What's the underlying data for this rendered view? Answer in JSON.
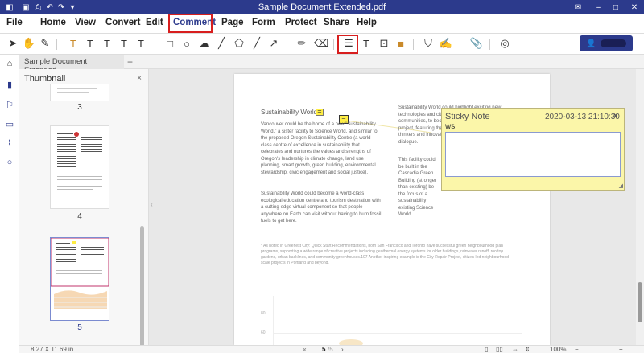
{
  "window": {
    "title": "Sample Document Extended.pdf"
  },
  "menubar": {
    "file": "File",
    "home": "Home",
    "view": "View",
    "convert": "Convert",
    "edit": "Edit",
    "comment": "Comment",
    "page": "Page",
    "form": "Form",
    "protect": "Protect",
    "share": "Share",
    "help": "Help"
  },
  "tabs": {
    "doc_tab": "Sample Document Extended",
    "add": "+"
  },
  "thumbnail": {
    "title": "Thumbnail",
    "close": "×",
    "pages": [
      "3",
      "4",
      "5"
    ]
  },
  "document": {
    "section_title": "Sustainability World",
    "para1": "Vancouver could be the home of a new \"Sustainability World,\" a sister facility to Science World, and similar to the proposed Oregon Sustainability Centre (a world-class centre of excellence in sustainability that celebrates and nurtures the values and strengths of Oregon's leadership in climate change, land use planning, smart growth, green building, environmental stewardship, civic engagement and social justice).",
    "para2": "Sustainability World could become a world-class ecological education centre and tourism destination with a cutting-edge virtual component so that people anywhere on Earth can visit without having to burn fossil fuels to get here.",
    "col2_a": "Sustainability World could highlight exciting new technologies and citizen initiatives, in partnership with communities, to become a leading demonstration project, featuring the work of the region's leading thinkers and innovators to engage the community dialogue.",
    "col2_b": "This facility could be built in the Cascadia Green Building (stronger than existing) be the focus of a sustainability existing Science World.",
    "footnote": "* As noted in Greenest City: Quick Start Recommendations, both San Francisco and Toronto have successful green neighbourhood plan programs, supporting a wide range of creative projects including geothermal energy systems for older buildings, rainwater runoff, rooftop gardens, urban backlines, and community greenhouses.107 Another inspiring example is the City Repair Project, citizen-led neighbourhood scale projects in Portland and beyond.",
    "chart_ticks": [
      "80",
      "60"
    ]
  },
  "sticky_note": {
    "title": "Sticky Note",
    "date": "2020-03-13 21:10:30",
    "close": "×",
    "body": "ws"
  },
  "status": {
    "page_size": "8.27 X 11.69 in",
    "page_current": "5",
    "page_total": "/5",
    "zoom": "100%"
  },
  "colors": {
    "brand": "#2c3a8c",
    "highlight": "#d81e1e",
    "note_bg": "#fbf6a9"
  }
}
